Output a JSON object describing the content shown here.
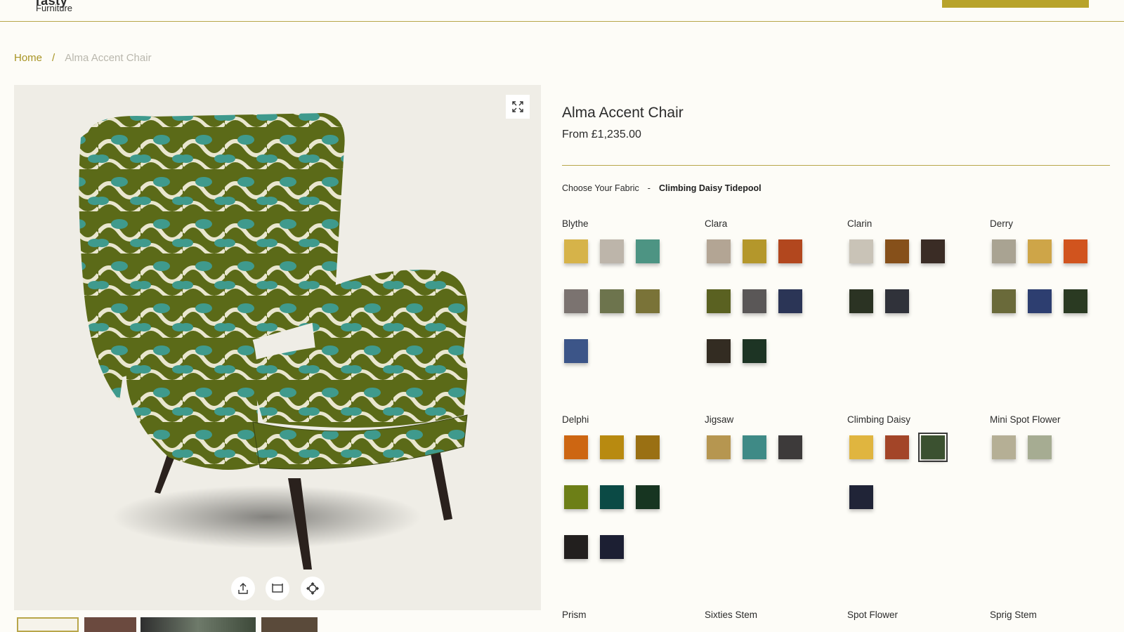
{
  "header": {
    "logo_main": "Tasty",
    "logo_sub": "Furniture"
  },
  "breadcrumb": {
    "home": "Home",
    "separator": "/",
    "current": "Alma Accent Chair"
  },
  "gallery": {
    "tools": [
      "share-icon",
      "resize-icon",
      "move-3d-icon"
    ],
    "fullscreen_icon": "expand-icon"
  },
  "product": {
    "title": "Alma Accent Chair",
    "price": "From £1,235.00",
    "fabric_label": "Choose Your Fabric",
    "fabric_separator": "-",
    "fabric_selected": "Climbing Daisy Tidepool"
  },
  "fabric_groups": [
    {
      "name": "Blythe",
      "swatches": [
        "#d6b349",
        "#bdb5aa",
        "#4d9483",
        "#7b7370",
        "#6d744d",
        "#7a7338",
        "#3c5588"
      ]
    },
    {
      "name": "Clara",
      "swatches": [
        "#b3a594",
        "#b4972b",
        "#b2471e",
        "#5a6121",
        "#5a5757",
        "#2b3556",
        "#332c22",
        "#1d3424"
      ]
    },
    {
      "name": "Clarin",
      "swatches": [
        "#c9c3b7",
        "#86501a",
        "#3a2c25",
        "#2b3323",
        "#30323a"
      ]
    },
    {
      "name": "Derry",
      "swatches": [
        "#a9a392",
        "#cea548",
        "#d1541e",
        "#6a6a3a",
        "#2d3e70",
        "#2a3a22"
      ]
    },
    {
      "name": "Delphi",
      "swatches": [
        "#cd6612",
        "#b88a10",
        "#9a7013",
        "#6d7f17",
        "#0b4a45",
        "#173521",
        "#221f1e",
        "#1c1f33"
      ]
    },
    {
      "name": "Jigsaw",
      "swatches": [
        "#b69650",
        "#3f8a86",
        "#3d3a3a"
      ]
    },
    {
      "name": "Climbing Daisy",
      "swatches": [
        "#e0b53f",
        "#a34528",
        "#3b5130",
        "#202437"
      ],
      "selected_index": 2
    },
    {
      "name": "Mini Spot Flower",
      "swatches": [
        "#b5af95",
        "#a6ac92"
      ]
    },
    {
      "name": "Prism",
      "swatches": []
    },
    {
      "name": "Sixties Stem",
      "swatches": []
    },
    {
      "name": "Spot Flower",
      "swatches": []
    },
    {
      "name": "Sprig Stem",
      "swatches": []
    }
  ]
}
